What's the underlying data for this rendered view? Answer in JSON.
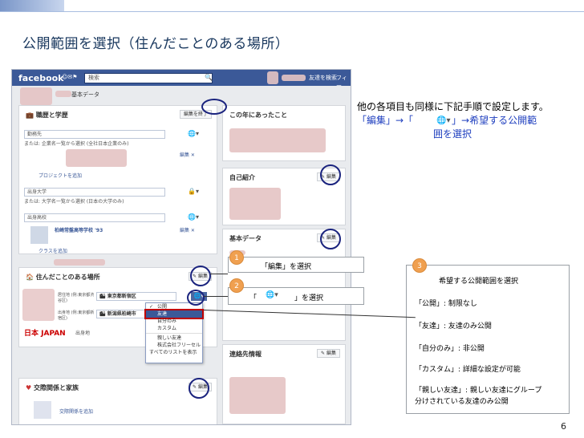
{
  "slide": {
    "title": "公開範囲を選択（住んだことのある場所）",
    "page_number": "6"
  },
  "fb": {
    "logo": "facebook",
    "search_placeholder": "検索",
    "nav_friends": "友達を検索",
    "nav_home": "フィー",
    "basic_data_btn": "基本データ",
    "work_section": "職歴と学歴",
    "edit_done": "編集を終了",
    "year_section": "この年にあったこと",
    "employer_placeholder": "勤務先",
    "employer_hint": "または: 企業名一覧から選択 (全社日本企業のみ)",
    "project_add": "プロジェクトを追加",
    "university_placeholder": "出身大学",
    "university_hint": "または: 大学名一覧から選択 (日本の大学のみ)",
    "highschool_placeholder": "出身高校",
    "highschool_value": "柏崎常盤高等学校 '93",
    "class_add": "クラスを追加",
    "edit_label": "編集",
    "self_intro": "自己紹介",
    "basic_data": "基本データ",
    "places_section": "住んだことのある場所",
    "current_city_label": "居住地 (例:東京都渋谷区)",
    "current_city_value": "東京都新宿区",
    "hometown_label": "出身地 (例:東京都新宿区)",
    "hometown_value": "新潟県柏崎市",
    "hometown_field": "出身地",
    "contact_section": "連絡先情報",
    "relationship_section": "交際関係と家族",
    "relationship_add": "交際関係を追加"
  },
  "dropdown": {
    "items": [
      "公開",
      "友達",
      "自分のみ",
      "カスタム",
      "親しい友達",
      "株式会社フリーセル",
      "すべてのリストを表示"
    ]
  },
  "annotations": {
    "note_line1": "他の各項目も同様に下記手順で設定します。",
    "note_line2": "「編集」→「　　　　」→希望する公開範",
    "note_line3": "囲を選択",
    "step1_badge": "1",
    "step1_text": "「編集」を選択",
    "step2_badge": "2",
    "step2_text_left": "「",
    "step2_text_right": "」を選択",
    "step3_badge": "3",
    "step3_title": "希望する公開範囲を選択",
    "opt_public": "「公開」: 制限なし",
    "opt_friends": "「友達」: 友達のみ公開",
    "opt_self": "「自分のみ」: 非公開",
    "opt_custom": "「カスタム」: 詳細な設定が可能",
    "opt_close1": "「親しい友達」: 親しい友達にグループ",
    "opt_close2": "分けされている友達のみ公開"
  },
  "colors": {
    "fb_blue": "#3b5998",
    "title": "#17365d",
    "highlight_circle": "#1a237e",
    "badge": "#f0a050"
  }
}
